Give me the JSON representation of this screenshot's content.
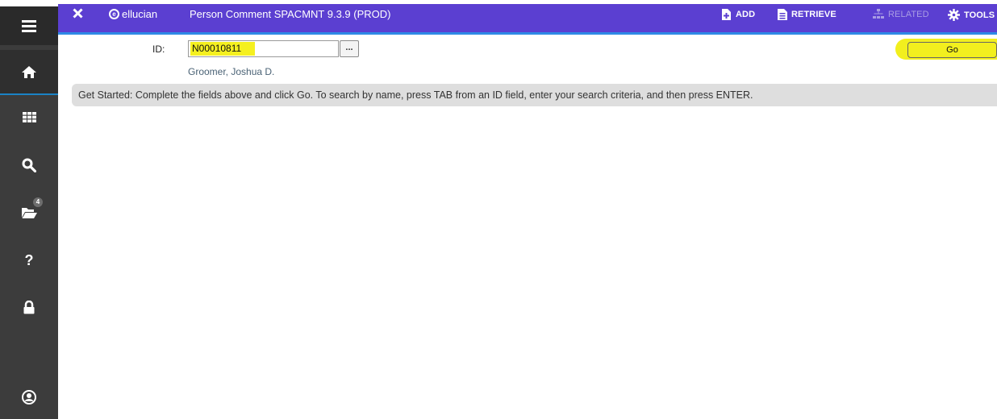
{
  "header": {
    "close_icon": "close-icon",
    "brand": "ellucian",
    "title": "Person Comment SPACMNT 9.3.9 (PROD)",
    "actions": {
      "add": "ADD",
      "retrieve": "RETRIEVE",
      "related": "RELATED",
      "tools": "TOOLS"
    },
    "colors": {
      "bar": "#5b3fd1",
      "underline": "#2e8ae6"
    }
  },
  "sidebar": {
    "items": [
      {
        "name": "menu",
        "icon": "menu-icon"
      },
      {
        "name": "home",
        "icon": "home-icon"
      },
      {
        "name": "applications",
        "icon": "grid-icon"
      },
      {
        "name": "search",
        "icon": "search-icon"
      },
      {
        "name": "recently-opened",
        "icon": "folder-open-icon",
        "badge": "4"
      },
      {
        "name": "help",
        "icon": "help-icon"
      },
      {
        "name": "sign-out",
        "icon": "lock-icon"
      },
      {
        "name": "user-profile",
        "icon": "user-icon"
      }
    ]
  },
  "key_block": {
    "id_label": "ID:",
    "id_value": "N00010811",
    "lookup_label": "...",
    "person_name": "Groomer, Joshua D.",
    "go_label": "Go"
  },
  "banner": {
    "text": "Get Started: Complete the fields above and click Go. To search by name, press TAB from an ID field, enter your search criteria, and then press ENTER."
  }
}
